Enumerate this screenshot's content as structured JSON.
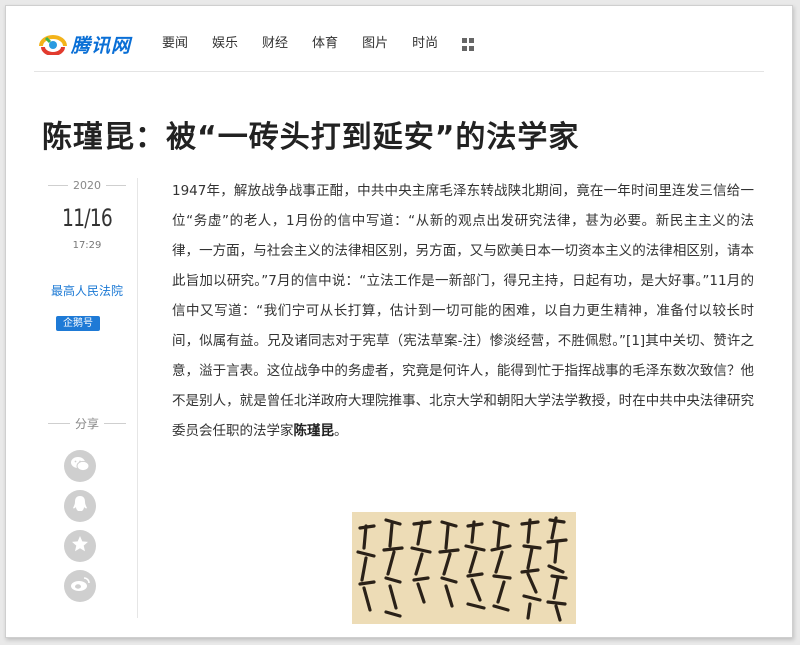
{
  "logo": {
    "text": "腾讯网"
  },
  "nav": {
    "items": [
      "要闻",
      "娱乐",
      "财经",
      "体育",
      "图片",
      "时尚"
    ]
  },
  "article": {
    "title": "陈瑾昆：被“一砖头打到延安”的法学家",
    "year": "2020",
    "monthday": "11/16",
    "time": "17:29",
    "source": "最高人民法院",
    "badge": "企鹅号",
    "body_prefix": "1947年，解放战争战事正酣，中共中央主席毛泽东转战陕北期间，竟在一年时间里连发三信给一位“务虚”的老人，1月份的信中写道：“从新的观点出发研究法律，甚为必要。新民主主义的法律，一方面，与社会主义的法律相区别，另方面，又与欧美日本一切资本主义的法律相区别，请本此旨加以研究。”7月的信中说：“立法工作是一新部门，得兄主持，日起有功，是大好事。”11月的信中又写道：“我们宁可从长打算，估计到一切可能的困难，以自力更生精神，准备付以较长时间，似属有益。兄及诸同志对于宪草（宪法草案-注）惨淡经营，不胜佩慰。”[1]其中关切、赞许之意，溢于言表。这位战争中的务虚者，究竟是何许人，能得到忙于指挥战事的毛泽东数次致信？他不是别人，就是曾任北洋政府大理院推事、北京大学和朝阳大学法学教授，时在中共中央法律研究委员会任职的法学家",
    "body_name": "陈瑾昆",
    "body_suffix": "。"
  },
  "share": {
    "label": "分享"
  },
  "colors": {
    "brand": "#0a6fd6",
    "source": "#1a78d4",
    "badge": "#1e7ad6",
    "share_icon": "#cfcfcf"
  },
  "icons": [
    "wechat-icon",
    "qq-icon",
    "qzone-star-icon",
    "weibo-icon",
    "more-grid-icon"
  ]
}
